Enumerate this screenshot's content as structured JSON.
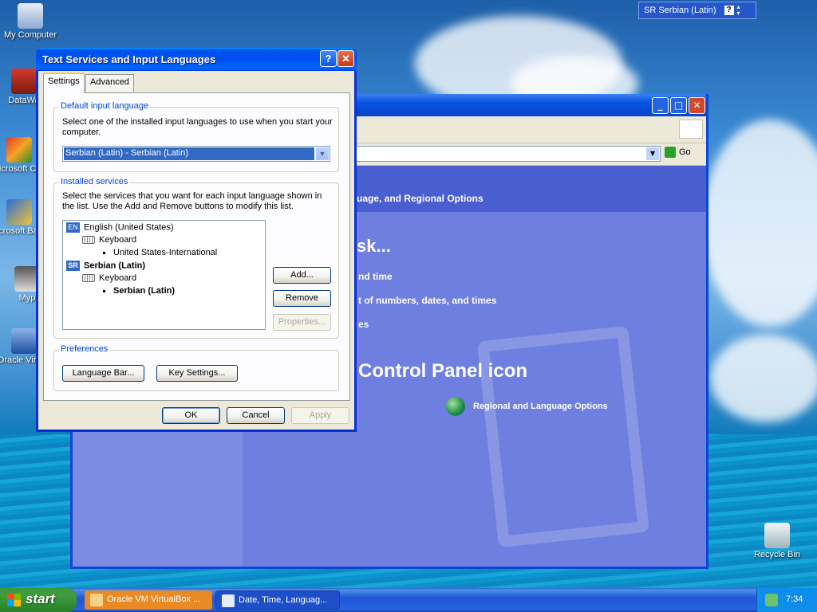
{
  "desktop": {
    "icons": [
      {
        "label": "My Computer"
      },
      {
        "label": "DataWa"
      },
      {
        "label": "Microsoft C++"
      },
      {
        "label": "Microsoft Basic"
      },
      {
        "label": "Myp"
      },
      {
        "label": "Oracle Virtual"
      },
      {
        "label": "Recycle Bin"
      }
    ]
  },
  "langbar": {
    "text": "SR Serbian (Latin)",
    "help": "?"
  },
  "background_window": {
    "go_label": "Go",
    "header_text": "uage, and Regional Options",
    "pick_task": "sk...",
    "tasks": [
      "nd time",
      "t of numbers, dates, and times",
      "es"
    ],
    "pick_icon": "Control Panel icon",
    "icon_label": "Regional and Language Options"
  },
  "dialog": {
    "title": "Text Services and Input Languages",
    "help_btn": "?",
    "close_btn": "✕",
    "tabs": [
      "Settings",
      "Advanced"
    ],
    "default_group": {
      "label": "Default input language",
      "description": "Select one of the installed input languages to use when you start your computer.",
      "selected": "Serbian (Latin) - Serbian (Latin)"
    },
    "installed_group": {
      "label": "Installed services",
      "description": "Select the services that you want for each input language shown in the list. Use the Add and Remove buttons to modify this list.",
      "tree": [
        {
          "badge": "EN",
          "label": "English (United States)"
        },
        {
          "label": "Keyboard"
        },
        {
          "label": "United States-International"
        },
        {
          "badge": "SR",
          "label": "Serbian (Latin)"
        },
        {
          "label": "Keyboard"
        },
        {
          "label": "Serbian (Latin)"
        }
      ],
      "add": "Add...",
      "remove": "Remove",
      "properties": "Properties..."
    },
    "preferences_group": {
      "label": "Preferences",
      "language_bar": "Language Bar...",
      "key_settings": "Key Settings..."
    },
    "ok": "OK",
    "cancel": "Cancel",
    "apply": "Apply"
  },
  "taskbar": {
    "start": "start",
    "tasks": [
      "Oracle VM VirtualBox ...",
      "Date, Time, Languag..."
    ],
    "clock": "7:34"
  }
}
